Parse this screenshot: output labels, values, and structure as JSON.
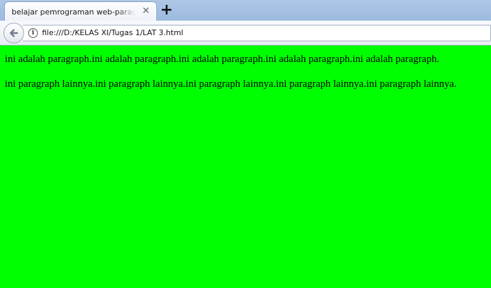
{
  "browser": {
    "tab_title": "belajar pemrograman web-paragraph",
    "tab_close_icon": "close-icon",
    "new_tab_label": "+",
    "back_icon": "back-arrow-icon",
    "info_icon_label": "i",
    "url": "file:///D:/KELAS XI/Tugas 1/LAT 3.html"
  },
  "page": {
    "background_color": "#00ff00",
    "paragraphs": [
      "ini adalah paragraph.ini adalah paragraph.ini adalah paragraph.ini adalah paragraph.ini adalah paragraph.",
      "ini paragraph lainnya.ini paragraph lainnya.ini paragraph lainnya.ini paragraph lainnya.ini paragraph lainnya."
    ]
  }
}
